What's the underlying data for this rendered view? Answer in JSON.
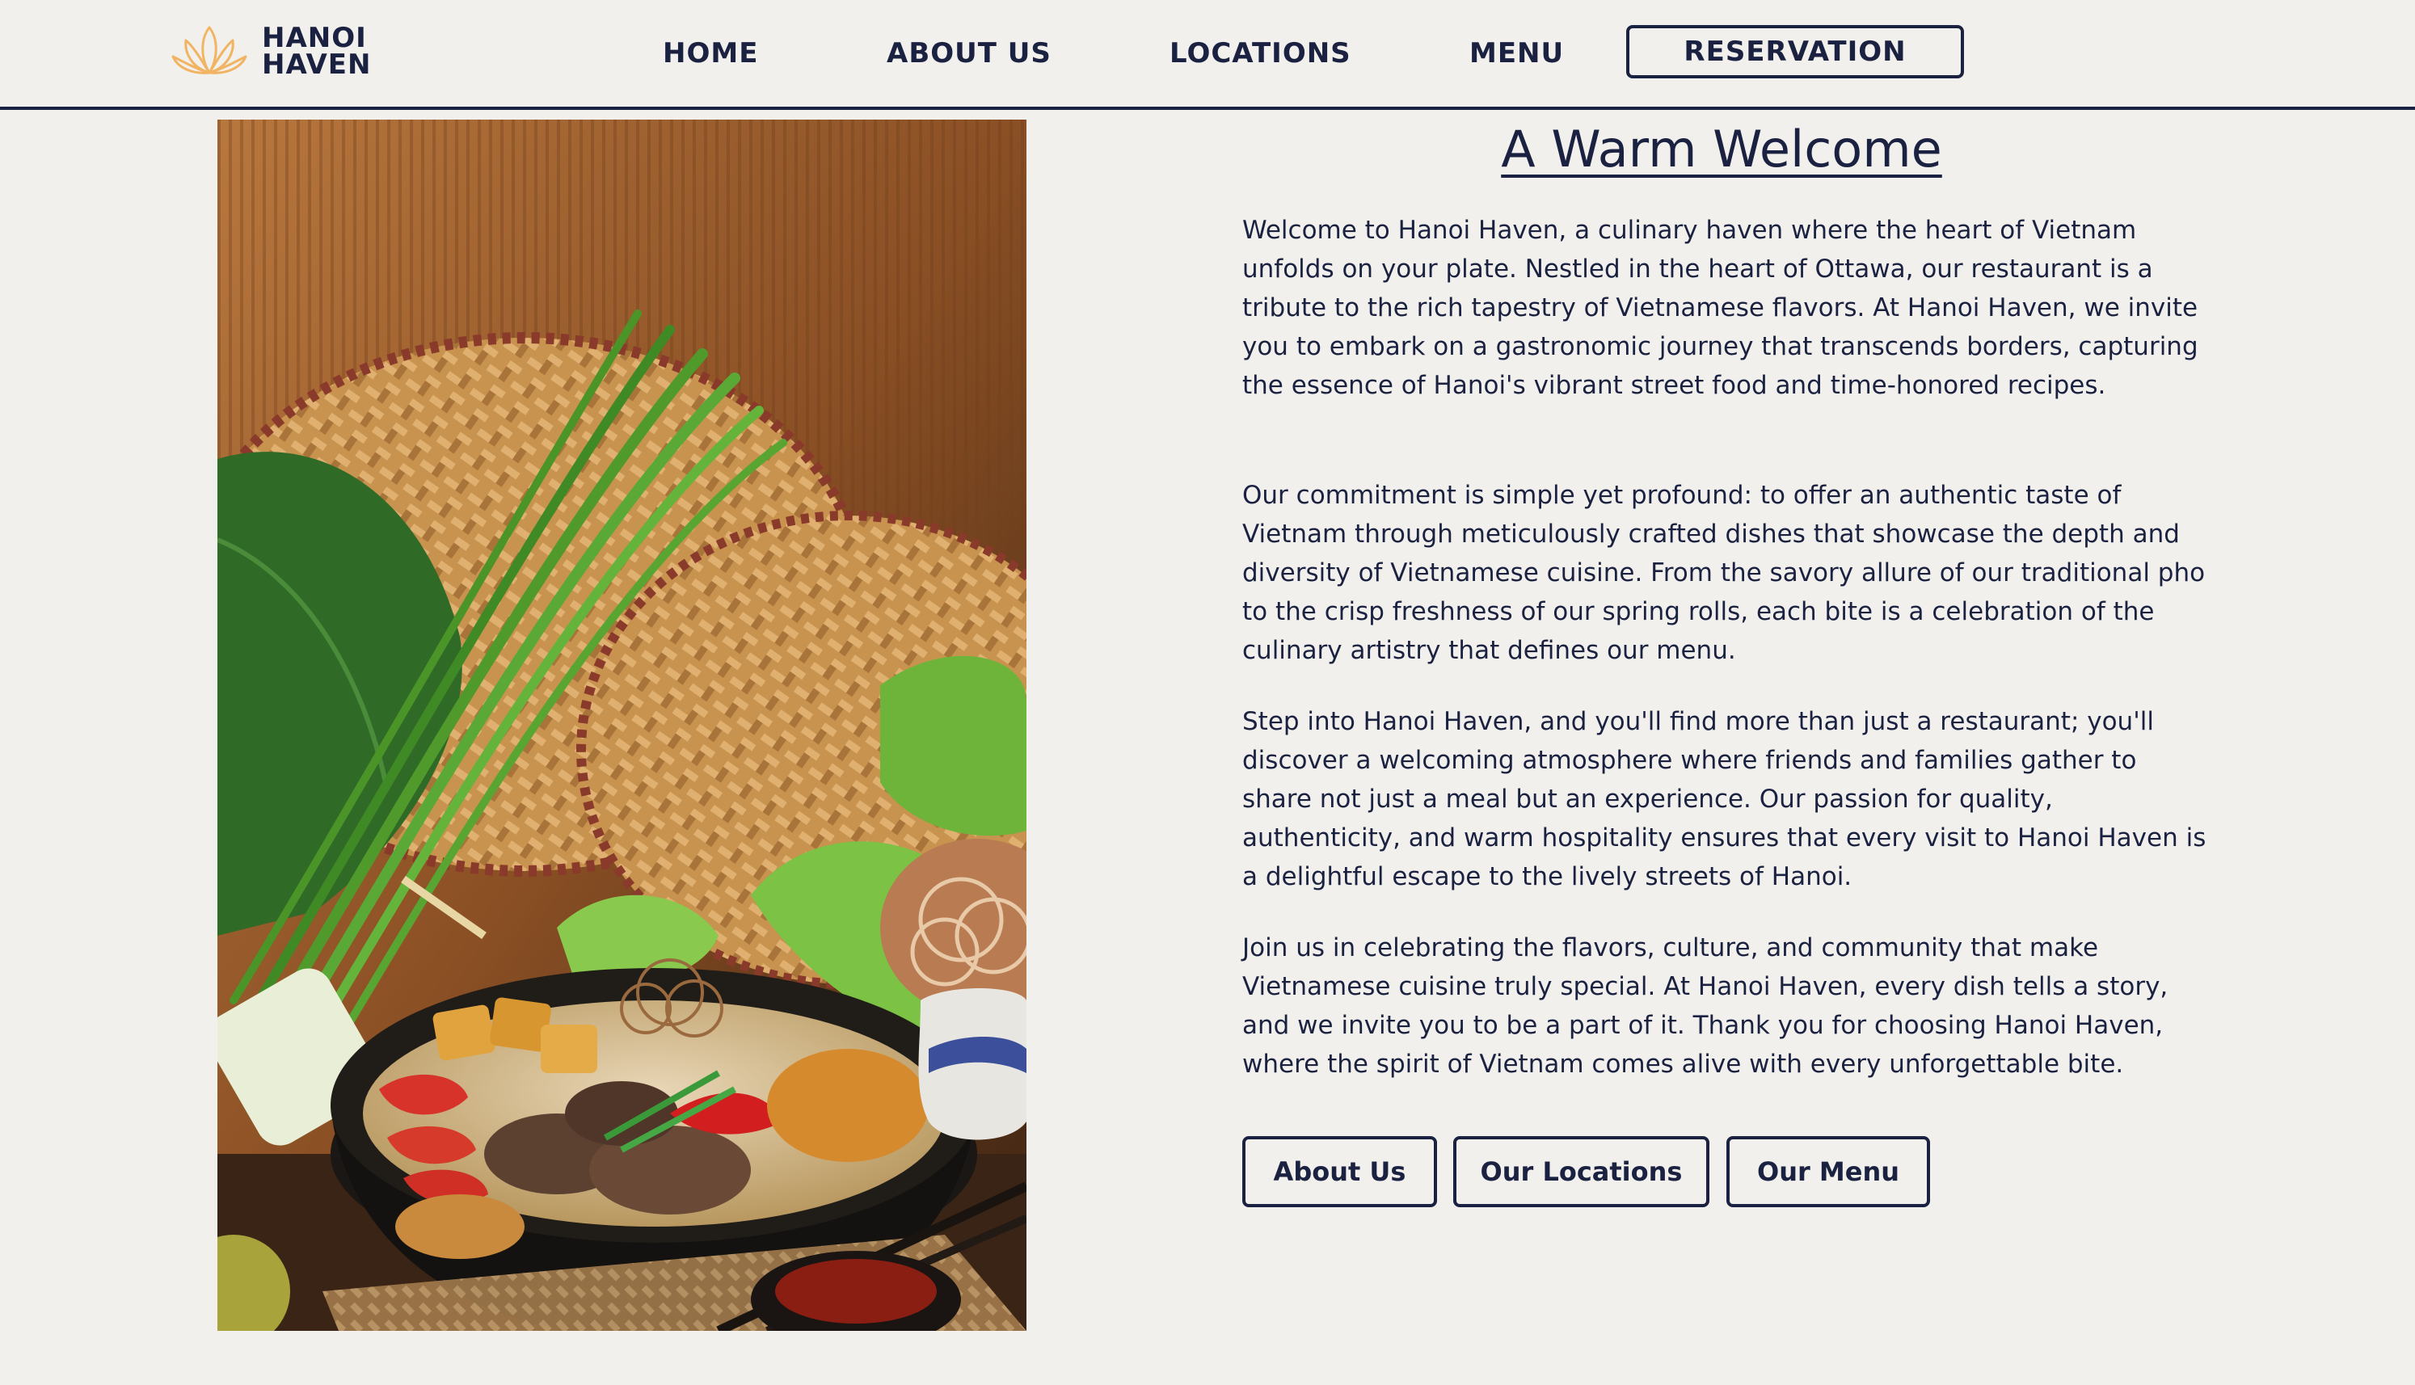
{
  "brand": {
    "line1": "HANOI",
    "line2": "HAVEN",
    "logo_icon": "lotus-icon",
    "logo_color": "#f0b463"
  },
  "nav": {
    "home": "HOME",
    "about": "ABOUT US",
    "locations": "LOCATIONS",
    "menu": "MENU",
    "reservation": "RESERVATION"
  },
  "hero_image": {
    "subject": "vietnamese-noodle-bowl-photo"
  },
  "content": {
    "title": "A Warm Welcome",
    "paragraphs": [
      "Welcome to Hanoi Haven, a culinary haven where the heart of Vietnam unfolds on your plate. Nestled in the heart of Ottawa, our restaurant is a tribute to the rich tapestry of Vietnamese flavors. At Hanoi Haven, we invite you to embark on a gastronomic journey that transcends borders, capturing the essence of Hanoi's vibrant street food and time-honored recipes.",
      "Our commitment is simple yet profound: to offer an authentic taste of Vietnam through meticulously crafted dishes that showcase the depth and diversity of Vietnamese cuisine. From the savory allure of our traditional pho to the crisp freshness of our spring rolls, each bite is a celebration of the culinary artistry that defines our menu.",
      "Step into Hanoi Haven, and you'll find more than just a restaurant; you'll discover a welcoming atmosphere where friends and families gather to share not just a meal but an experience. Our passion for quality, authenticity, and warm hospitality ensures that every visit to Hanoi Haven is a delightful escape to the lively streets of Hanoi.",
      "Join us in celebrating the flavors, culture, and community that make Vietnamese cuisine truly special. At Hanoi Haven, every dish tells a story, and we invite you to be a part of it. Thank you for choosing Hanoi Haven, where the spirit of Vietnam comes alive with every unforgettable bite."
    ],
    "buttons": {
      "about": "About Us",
      "locations": "Our Locations",
      "menu": "Our Menu"
    }
  },
  "colors": {
    "background": "#f1f0ec",
    "navy": "#1b2241"
  }
}
